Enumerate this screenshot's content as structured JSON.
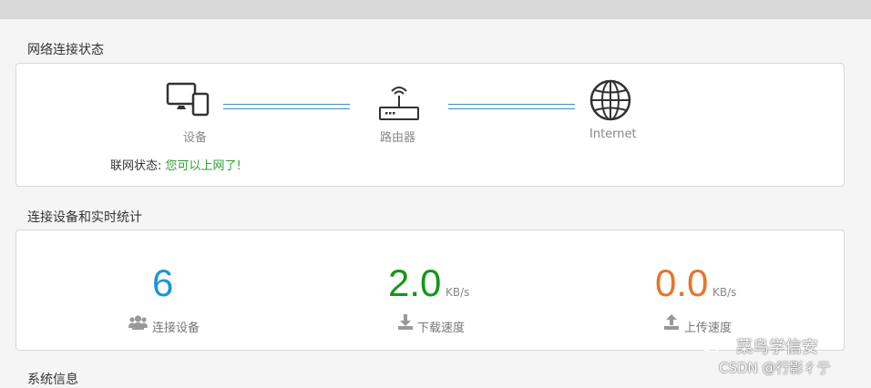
{
  "sections": {
    "connection_status_title": "网络连接状态",
    "devices_stats_title": "连接设备和实时统计",
    "system_info_title": "系统信息"
  },
  "topology": {
    "device_label": "设备",
    "router_label": "路由器",
    "internet_label": "Internet",
    "link_color": "#3a8fb7"
  },
  "status": {
    "label": "联网状态:",
    "value": "您可以上网了!",
    "value_color": "#2ea02e"
  },
  "stats": {
    "devices": {
      "value": "6",
      "label": "连接设备",
      "color": "#1a97d4",
      "icon": "users-icon"
    },
    "download": {
      "value": "2.0",
      "unit": "KB/s",
      "label": "下载速度",
      "color": "#15961a",
      "icon": "download-icon"
    },
    "upload": {
      "value": "0.0",
      "unit": "KB/s",
      "label": "上传速度",
      "color": "#e8742d",
      "icon": "upload-icon"
    }
  },
  "watermark": {
    "line1": "菜鸟学信安",
    "line2": "CSDN @行影彳亍"
  }
}
